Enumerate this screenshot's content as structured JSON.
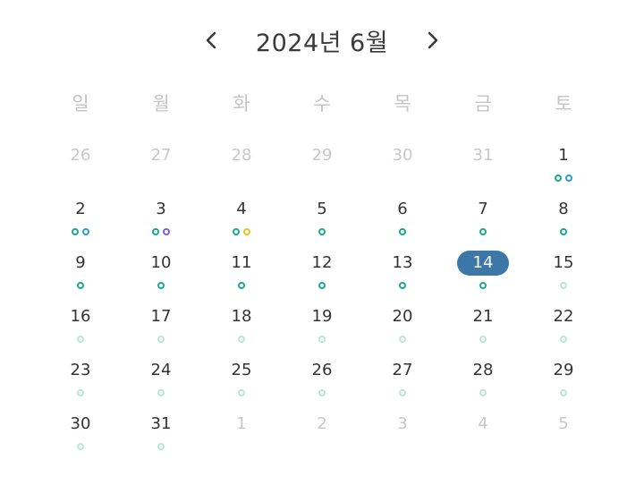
{
  "header": {
    "title": "2024년 6월",
    "prev_icon": "chevron-left-icon",
    "next_icon": "chevron-right-icon"
  },
  "weekdays": [
    "일",
    "월",
    "화",
    "수",
    "목",
    "금",
    "토"
  ],
  "colors": {
    "today_bg": "#3d77a7",
    "dot_green": "#1aaa8a",
    "dot_blue": "#2a9bd6",
    "dot_purple": "#7b5fe0",
    "dot_yellow": "#f0c020",
    "dot_light": "#b9e7d6",
    "muted_text": "#c8c8c8"
  },
  "weeks": [
    [
      {
        "day": "26",
        "muted": true,
        "dots": []
      },
      {
        "day": "27",
        "muted": true,
        "dots": []
      },
      {
        "day": "28",
        "muted": true,
        "dots": []
      },
      {
        "day": "29",
        "muted": true,
        "dots": []
      },
      {
        "day": "30",
        "muted": true,
        "dots": []
      },
      {
        "day": "31",
        "muted": true,
        "dots": []
      },
      {
        "day": "1",
        "dots": [
          "dot_green",
          "dot_blue"
        ]
      }
    ],
    [
      {
        "day": "2",
        "dots": [
          "dot_green",
          "dot_blue"
        ]
      },
      {
        "day": "3",
        "dots": [
          "dot_green",
          "dot_purple"
        ]
      },
      {
        "day": "4",
        "dots": [
          "dot_green",
          "dot_yellow"
        ]
      },
      {
        "day": "5",
        "dots": [
          "dot_green"
        ]
      },
      {
        "day": "6",
        "dots": [
          "dot_green"
        ]
      },
      {
        "day": "7",
        "dots": [
          "dot_green"
        ]
      },
      {
        "day": "8",
        "dots": [
          "dot_green"
        ]
      }
    ],
    [
      {
        "day": "9",
        "dots": [
          "dot_green"
        ]
      },
      {
        "day": "10",
        "dots": [
          "dot_green"
        ]
      },
      {
        "day": "11",
        "dots": [
          "dot_green"
        ]
      },
      {
        "day": "12",
        "dots": [
          "dot_green"
        ]
      },
      {
        "day": "13",
        "dots": [
          "dot_green"
        ]
      },
      {
        "day": "14",
        "today": true,
        "dots": [
          "dot_green"
        ]
      },
      {
        "day": "15",
        "dots": [
          "dot_light"
        ]
      }
    ],
    [
      {
        "day": "16",
        "dots": [
          "dot_light"
        ]
      },
      {
        "day": "17",
        "dots": [
          "dot_light"
        ]
      },
      {
        "day": "18",
        "dots": [
          "dot_light"
        ]
      },
      {
        "day": "19",
        "dots": [
          "dot_light"
        ]
      },
      {
        "day": "20",
        "dots": [
          "dot_light"
        ]
      },
      {
        "day": "21",
        "dots": [
          "dot_light"
        ]
      },
      {
        "day": "22",
        "dots": [
          "dot_light"
        ]
      }
    ],
    [
      {
        "day": "23",
        "dots": [
          "dot_light"
        ]
      },
      {
        "day": "24",
        "dots": [
          "dot_light"
        ]
      },
      {
        "day": "25",
        "dots": [
          "dot_light"
        ]
      },
      {
        "day": "26",
        "dots": [
          "dot_light"
        ]
      },
      {
        "day": "27",
        "dots": [
          "dot_light"
        ]
      },
      {
        "day": "28",
        "dots": [
          "dot_light"
        ]
      },
      {
        "day": "29",
        "dots": [
          "dot_light"
        ]
      }
    ],
    [
      {
        "day": "30",
        "dots": [
          "dot_light"
        ]
      },
      {
        "day": "31",
        "dots": [
          "dot_light"
        ]
      },
      {
        "day": "1",
        "muted": true,
        "dots": []
      },
      {
        "day": "2",
        "muted": true,
        "dots": []
      },
      {
        "day": "3",
        "muted": true,
        "dots": []
      },
      {
        "day": "4",
        "muted": true,
        "dots": []
      },
      {
        "day": "5",
        "muted": true,
        "dots": []
      }
    ]
  ]
}
